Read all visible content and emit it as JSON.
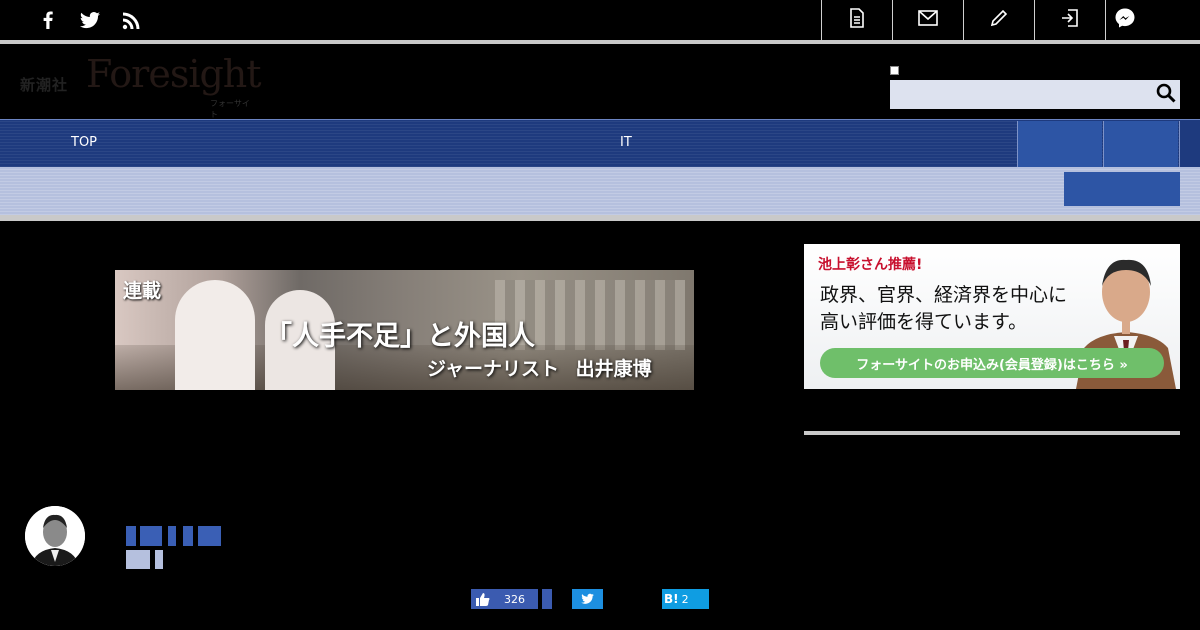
{
  "logo": {
    "publisher": "新潮社",
    "name": "Foresight",
    "kana": "フォーサイト"
  },
  "search": {
    "placeholder": ""
  },
  "nav": {
    "items": [
      "TOP",
      "IT"
    ]
  },
  "banner": {
    "tag": "連載",
    "title": "「人手不足」と外国人",
    "byline": "ジャーナリスト 出井康博"
  },
  "ad": {
    "recommend": "池上彰さん推薦!",
    "copy_line1": "政界、官界、経済界を中心に",
    "copy_line2": "高い評価を得ています。",
    "cta": "フォーサイトのお申込み(会員登録)はこちら »"
  },
  "share": {
    "facebook_count": "326",
    "hatena_label": "B!",
    "hatena_count": "2"
  },
  "colors": {
    "nav_blue": "#1e3a7e",
    "nav_box": "#2d55a5",
    "subnav": "#b5c0de",
    "cta_green": "#6fbf6a",
    "accent_red": "#c8102e"
  }
}
